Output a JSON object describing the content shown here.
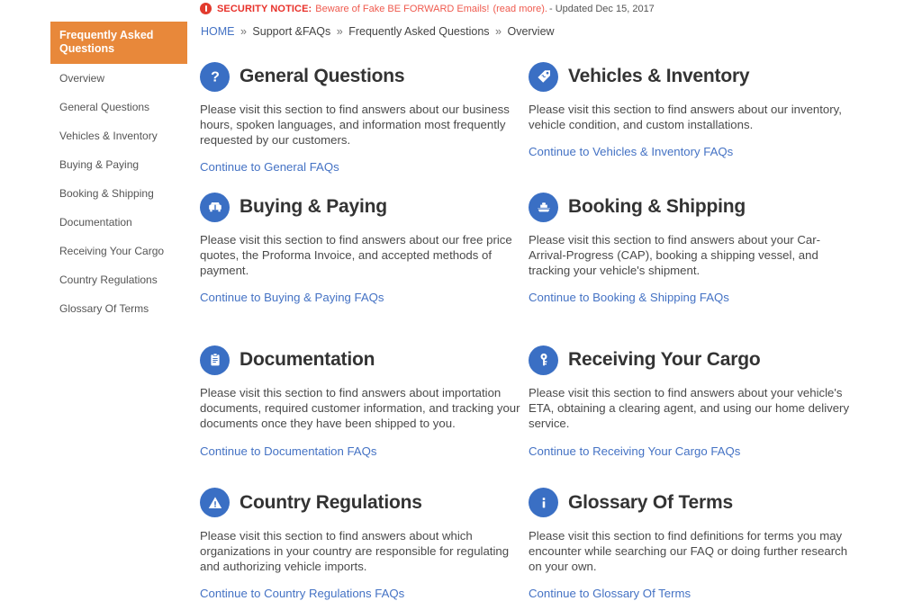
{
  "notice": {
    "icon": "alert-circle-icon",
    "label": "SECURITY NOTICE:",
    "message": "Beware of Fake BE FORWARD Emails!",
    "read_more": "(read more).",
    "updated": "- Updated Dec 15, 2017"
  },
  "breadcrumb": {
    "items": [
      "HOME",
      "Support &FAQs",
      "Frequently Asked Questions",
      "Overview"
    ],
    "separator": "»"
  },
  "sidebar": {
    "header": "Frequently Asked Questions",
    "header_color": "#E8883A",
    "items": [
      {
        "label": "Overview"
      },
      {
        "label": "General Questions"
      },
      {
        "label": "Vehicles & Inventory"
      },
      {
        "label": "Buying & Paying"
      },
      {
        "label": "Booking & Shipping"
      },
      {
        "label": "Documentation"
      },
      {
        "label": "Receiving Your Cargo"
      },
      {
        "label": "Country Regulations"
      },
      {
        "label": "Glossary Of Terms"
      }
    ]
  },
  "theme": {
    "icon_blue": "#3A6FC4",
    "link_blue": "#4472C4",
    "heading_gray": "#333333",
    "notice_red": "#E8312A"
  },
  "cards": [
    {
      "icon": "question-mark-icon",
      "title": "General Questions",
      "body": "Please visit this section to find answers about our business hours, spoken languages, and information most frequently requested by our customers.",
      "link": "Continue to General FAQs"
    },
    {
      "icon": "price-tag-icon",
      "title": "Vehicles & Inventory",
      "body": "Please visit this section to find answers about our inventory, vehicle condition, and custom installations.",
      "link": "Continue to Vehicles & Inventory FAQs"
    },
    {
      "icon": "car-front-icon",
      "title": "Buying & Paying",
      "body": "Please visit this section to find answers about our free price quotes, the Proforma Invoice, and accepted methods of payment.",
      "link": "Continue to Buying & Paying FAQs"
    },
    {
      "icon": "ship-icon",
      "title": "Booking & Shipping",
      "body": "Please visit this section to find answers about your Car-Arrival-Progress (CAP), booking a shipping vessel, and tracking your vehicle's shipment.",
      "link": "Continue to Booking & Shipping FAQs"
    },
    {
      "icon": "clipboard-icon",
      "title": "Documentation",
      "body": "Please visit this section to find answers about importation documents, required customer information, and tracking your documents once they have been shipped to you.",
      "link": "Continue to Documentation FAQs"
    },
    {
      "icon": "key-icon",
      "title": "Receiving Your Cargo",
      "body": "Please visit this section to find answers about your vehicle's ETA, obtaining a clearing agent, and using our home delivery service.",
      "link": "Continue to Receiving Your Cargo FAQs"
    },
    {
      "icon": "warning-triangle-icon",
      "title": "Country Regulations",
      "body": "Please visit this section to find answers about which organizations in your country are responsible for regulating and authorizing vehicle imports.",
      "link": "Continue to Country Regulations FAQs"
    },
    {
      "icon": "info-icon",
      "title": "Glossary Of Terms",
      "body": "Please visit this section to find definitions for terms you may encounter while searching our FAQ or doing further research on your own.",
      "link": "Continue to Glossary Of Terms"
    }
  ]
}
